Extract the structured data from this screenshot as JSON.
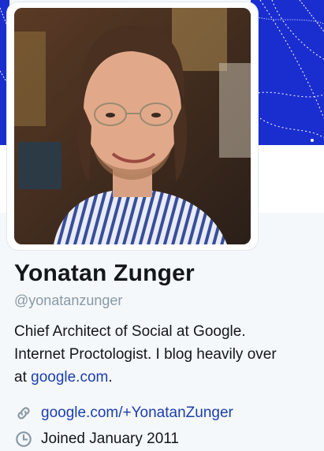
{
  "profile": {
    "name": "Yonatan Zunger",
    "handle": "@yonatanzunger",
    "bio_line1": "Chief Architect of Social at Google.",
    "bio_line2": "Internet Proctologist. I blog heavily over",
    "bio_line3_prefix": "at ",
    "bio_link": "google.com",
    "bio_line3_suffix": "."
  },
  "meta": {
    "website": "google.com/+YonatanZunger",
    "joined": "Joined January 2011",
    "website_icon": "link-icon",
    "joined_icon": "clock-icon"
  },
  "colors": {
    "link": "#1b3eae",
    "banner": "#1a2ed0",
    "muted": "#8899a6"
  }
}
